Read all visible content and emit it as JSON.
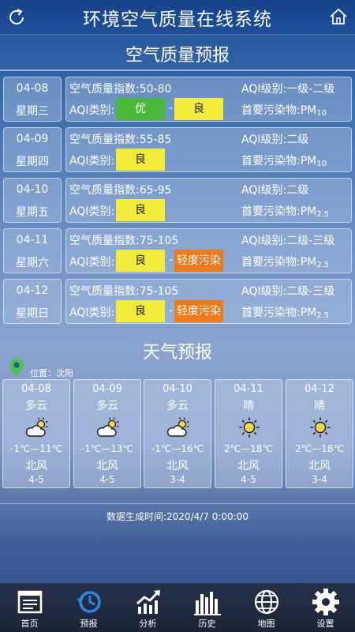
{
  "app": {
    "title": "环境空气质量在线系统"
  },
  "aq": {
    "title": "空气质量预报",
    "rows": [
      {
        "date": "04-08",
        "weekday": "星期三",
        "index": "空气质量指数:50-80",
        "level": "AQI级别:一级-二级",
        "category_label": "AQI类别:",
        "badges": [
          {
            "text": "优",
            "color": "#4cb83a",
            "fg": "#ffffff"
          },
          {
            "text": "良",
            "color": "#f2ec3a",
            "fg": "#222222"
          }
        ],
        "dash": "-",
        "pollutant_label": "首要污染物:PM",
        "pollutant_sub": "10"
      },
      {
        "date": "04-09",
        "weekday": "星期四",
        "index": "空气质量指数:55-85",
        "level": "AQI级别:二级",
        "category_label": "AQI类别:",
        "badges": [
          {
            "text": "良",
            "color": "#f2ec3a",
            "fg": "#222222"
          }
        ],
        "dash": "",
        "pollutant_label": "首要污染物:PM",
        "pollutant_sub": "10"
      },
      {
        "date": "04-10",
        "weekday": "星期五",
        "index": "空气质量指数:65-95",
        "level": "AQI级别:二级",
        "category_label": "AQI类别:",
        "badges": [
          {
            "text": "良",
            "color": "#f2ec3a",
            "fg": "#222222"
          }
        ],
        "dash": "",
        "pollutant_label": "首要污染物:PM",
        "pollutant_sub": "2.5"
      },
      {
        "date": "04-11",
        "weekday": "星期六",
        "index": "空气质量指数:75-105",
        "level": "AQI级别:二级-三级",
        "category_label": "AQI类别:",
        "badges": [
          {
            "text": "良",
            "color": "#f2ec3a",
            "fg": "#222222"
          },
          {
            "text": "轻度污染",
            "color": "#f07a1a",
            "fg": "#ffffff"
          }
        ],
        "dash": "-",
        "pollutant_label": "首要污染物:PM",
        "pollutant_sub": "2.5"
      },
      {
        "date": "04-12",
        "weekday": "星期日",
        "index": "空气质量指数:75-105",
        "level": "AQI级别:二级-三级",
        "category_label": "AQI类别:",
        "badges": [
          {
            "text": "良",
            "color": "#f2ec3a",
            "fg": "#222222"
          },
          {
            "text": "轻度污染",
            "color": "#f07a1a",
            "fg": "#ffffff"
          }
        ],
        "dash": "-",
        "pollutant_label": "首要污染物:PM",
        "pollutant_sub": "2.5"
      }
    ]
  },
  "weather": {
    "title": "天气预报",
    "location": "位置：沈阳",
    "days": [
      {
        "date": "04-08",
        "cond": "多云",
        "icon": "partly-cloudy-icon",
        "temp": "-1℃—11℃",
        "wind": "北风",
        "wind_level": "4-5"
      },
      {
        "date": "04-09",
        "cond": "多云",
        "icon": "partly-cloudy-icon",
        "temp": "-1℃—13℃",
        "wind": "北风",
        "wind_level": "4-5"
      },
      {
        "date": "04-10",
        "cond": "多云",
        "icon": "partly-cloudy-icon",
        "temp": "-1℃—16℃",
        "wind": "北风",
        "wind_level": "3-4"
      },
      {
        "date": "04-11",
        "cond": "晴",
        "icon": "sun-icon",
        "temp": "2℃—18℃",
        "wind": "北风",
        "wind_level": "4-5"
      },
      {
        "date": "04-12",
        "cond": "晴",
        "icon": "sun-icon",
        "temp": "2℃—18℃",
        "wind": "北风",
        "wind_level": "3-4"
      }
    ]
  },
  "generated": "数据生成时间:2020/4/7 0:00:00",
  "nav": [
    {
      "label": "首页",
      "icon": "home-doc-icon"
    },
    {
      "label": "预报",
      "icon": "history-clock-icon"
    },
    {
      "label": "分析",
      "icon": "trend-chart-icon"
    },
    {
      "label": "历史",
      "icon": "bar-chart-icon"
    },
    {
      "label": "地图",
      "icon": "globe-icon"
    },
    {
      "label": "设置",
      "icon": "gear-icon"
    }
  ]
}
